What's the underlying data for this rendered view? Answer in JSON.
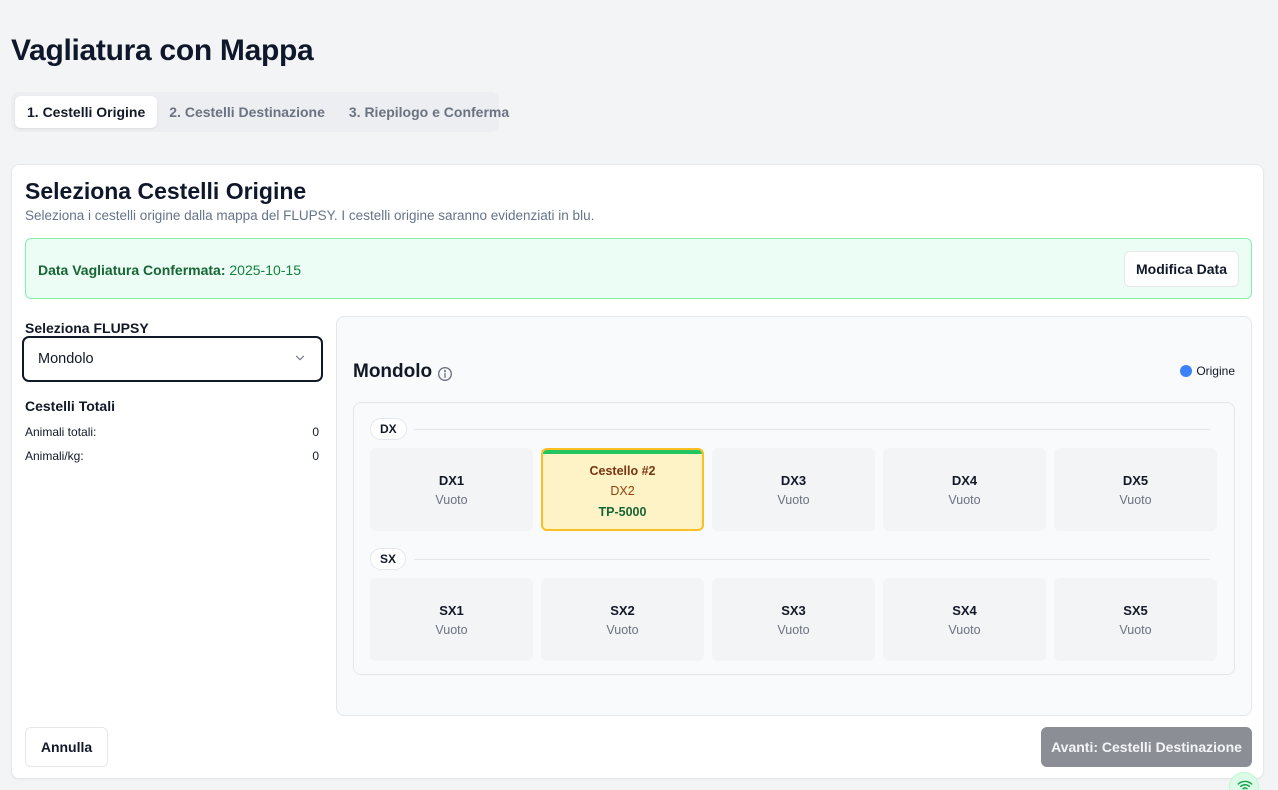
{
  "page": {
    "title": "Vagliatura con Mappa"
  },
  "tabs": [
    {
      "label": "1. Cestelli Origine",
      "active": true
    },
    {
      "label": "2. Cestelli Destinazione",
      "active": false
    },
    {
      "label": "3. Riepilogo e Conferma",
      "active": false
    }
  ],
  "card": {
    "title": "Seleziona Cestelli Origine",
    "description": "Seleziona i cestelli origine dalla mappa del FLUPSY. I cestelli origine saranno evidenziati in blu."
  },
  "date_box": {
    "label": "Data Vagliatura Confermata:",
    "value": "2025-10-15",
    "button_label": "Modifica Data"
  },
  "flupsy": {
    "label": "Seleziona FLUPSY",
    "selected": "Mondolo"
  },
  "totals": {
    "title": "Cestelli Totali",
    "rows": [
      {
        "label": "Animali totali:",
        "value": "0"
      },
      {
        "label": "Animali/kg:",
        "value": "0"
      }
    ]
  },
  "map": {
    "title": "Mondolo",
    "legend": {
      "label": "Origine",
      "color": "#3b82f6"
    },
    "rows": [
      {
        "label": "DX",
        "cells": [
          {
            "name": "DX1",
            "status": "Vuoto"
          },
          {
            "title": "Cestello #2",
            "name": "DX2",
            "size": "TP-5000",
            "selected": true
          },
          {
            "name": "DX3",
            "status": "Vuoto"
          },
          {
            "name": "DX4",
            "status": "Vuoto"
          },
          {
            "name": "DX5",
            "status": "Vuoto"
          }
        ]
      },
      {
        "label": "SX",
        "cells": [
          {
            "name": "SX1",
            "status": "Vuoto"
          },
          {
            "name": "SX2",
            "status": "Vuoto"
          },
          {
            "name": "SX3",
            "status": "Vuoto"
          },
          {
            "name": "SX4",
            "status": "Vuoto"
          },
          {
            "name": "SX5",
            "status": "Vuoto"
          }
        ]
      }
    ]
  },
  "actions": {
    "cancel_label": "Annulla",
    "next_label": "Avanti: Cestelli Destinazione"
  },
  "colors": {
    "selected_fill": "#fef3c7",
    "selected_border": "#fbbf24",
    "selected_bar": "#22c55e",
    "confirm_box": "#ecfdf5",
    "disabled_button": "#8b8f95"
  },
  "icons": {
    "dropdown": "chevron-down-icon",
    "info": "info-icon",
    "connection": "wifi-icon"
  }
}
